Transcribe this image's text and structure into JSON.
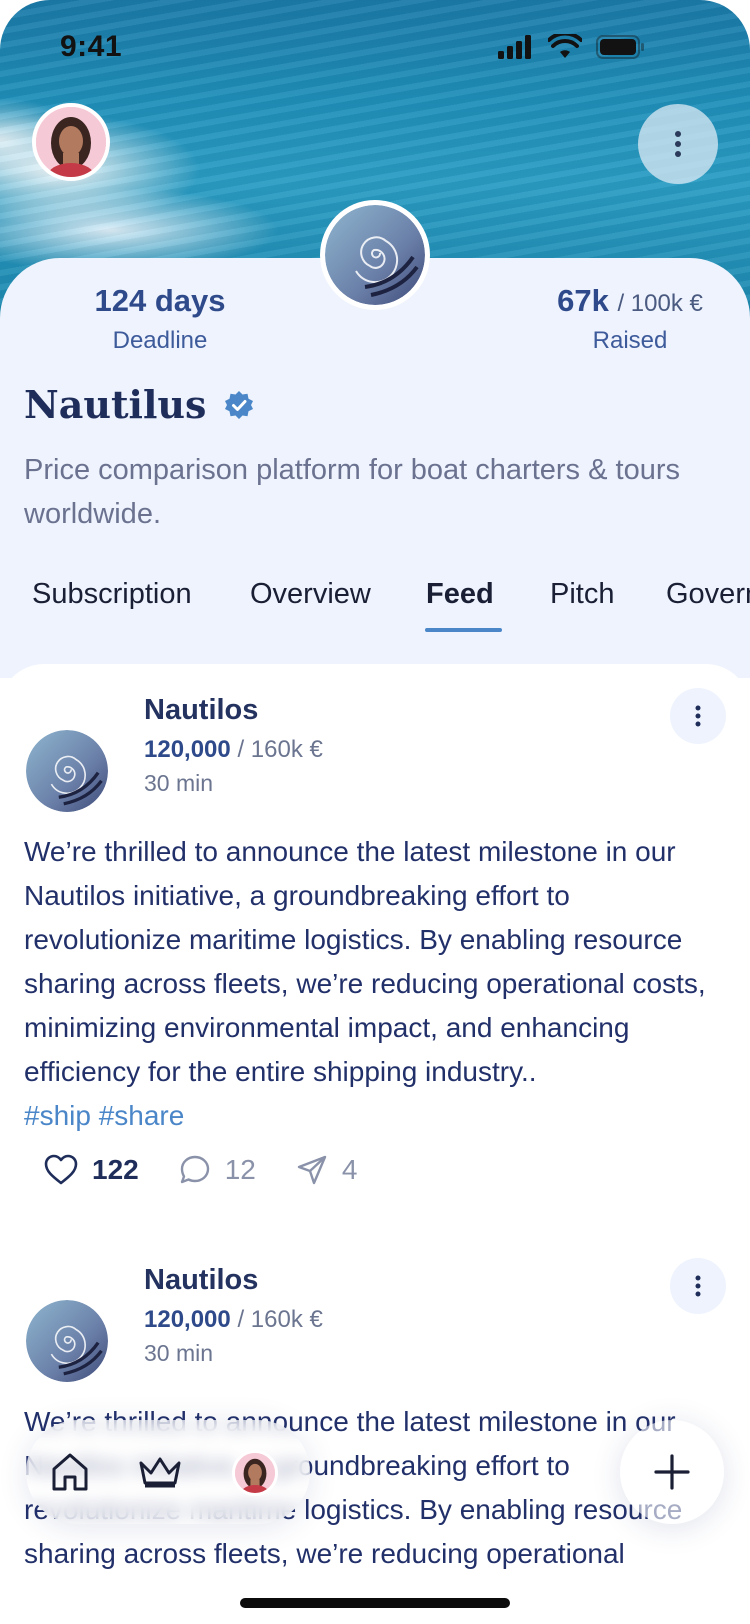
{
  "status_bar": {
    "time": "9:41"
  },
  "project": {
    "deadline_value": "124 days",
    "deadline_label": "Deadline",
    "raised_value": "67k",
    "raised_total": "/ 100k €",
    "raised_label": "Raised",
    "name": "Nautilus",
    "description": "Price comparison platform for boat charters & tours worldwide."
  },
  "tabs": [
    {
      "label": "Subscription"
    },
    {
      "label": "Overview"
    },
    {
      "label": "Feed",
      "active": true
    },
    {
      "label": "Pitch"
    },
    {
      "label": "Govern"
    }
  ],
  "posts": [
    {
      "author": "Nautilos",
      "amount": "120,000",
      "amount_total": "/ 160k €",
      "time": "30 min",
      "body": "We’re thrilled to announce the latest milestone in our Nautilos initiative, a groundbreaking effort to revolutionize maritime logistics. By enabling resource sharing across fleets, we’re reducing operational costs, minimizing environmental impact, and enhancing efficiency for the entire shipping industry..",
      "tags": "#ship #share",
      "likes": "122",
      "comments": "12",
      "shares": "4"
    },
    {
      "author": "Nautilos",
      "amount": "120,000",
      "amount_total": "/ 160k €",
      "time": "30 min",
      "body": "We’re thrilled to announce the latest milestone in our Nautilos initiative, a groundbreaking effort to revolutionize maritime logistics. By enabling resource sharing across fleets, we’re reducing operational"
    }
  ],
  "icons": {
    "verified": "verified-badge-icon",
    "more": "more-vertical-icon",
    "like": "heart-icon",
    "comment": "comment-icon",
    "share": "send-icon",
    "home": "home-icon",
    "crown": "crown-icon",
    "add": "plus-icon"
  },
  "colors": {
    "accent": "#4a86c8",
    "title": "#1f2d5a",
    "card_bg": "#eef3fd"
  }
}
